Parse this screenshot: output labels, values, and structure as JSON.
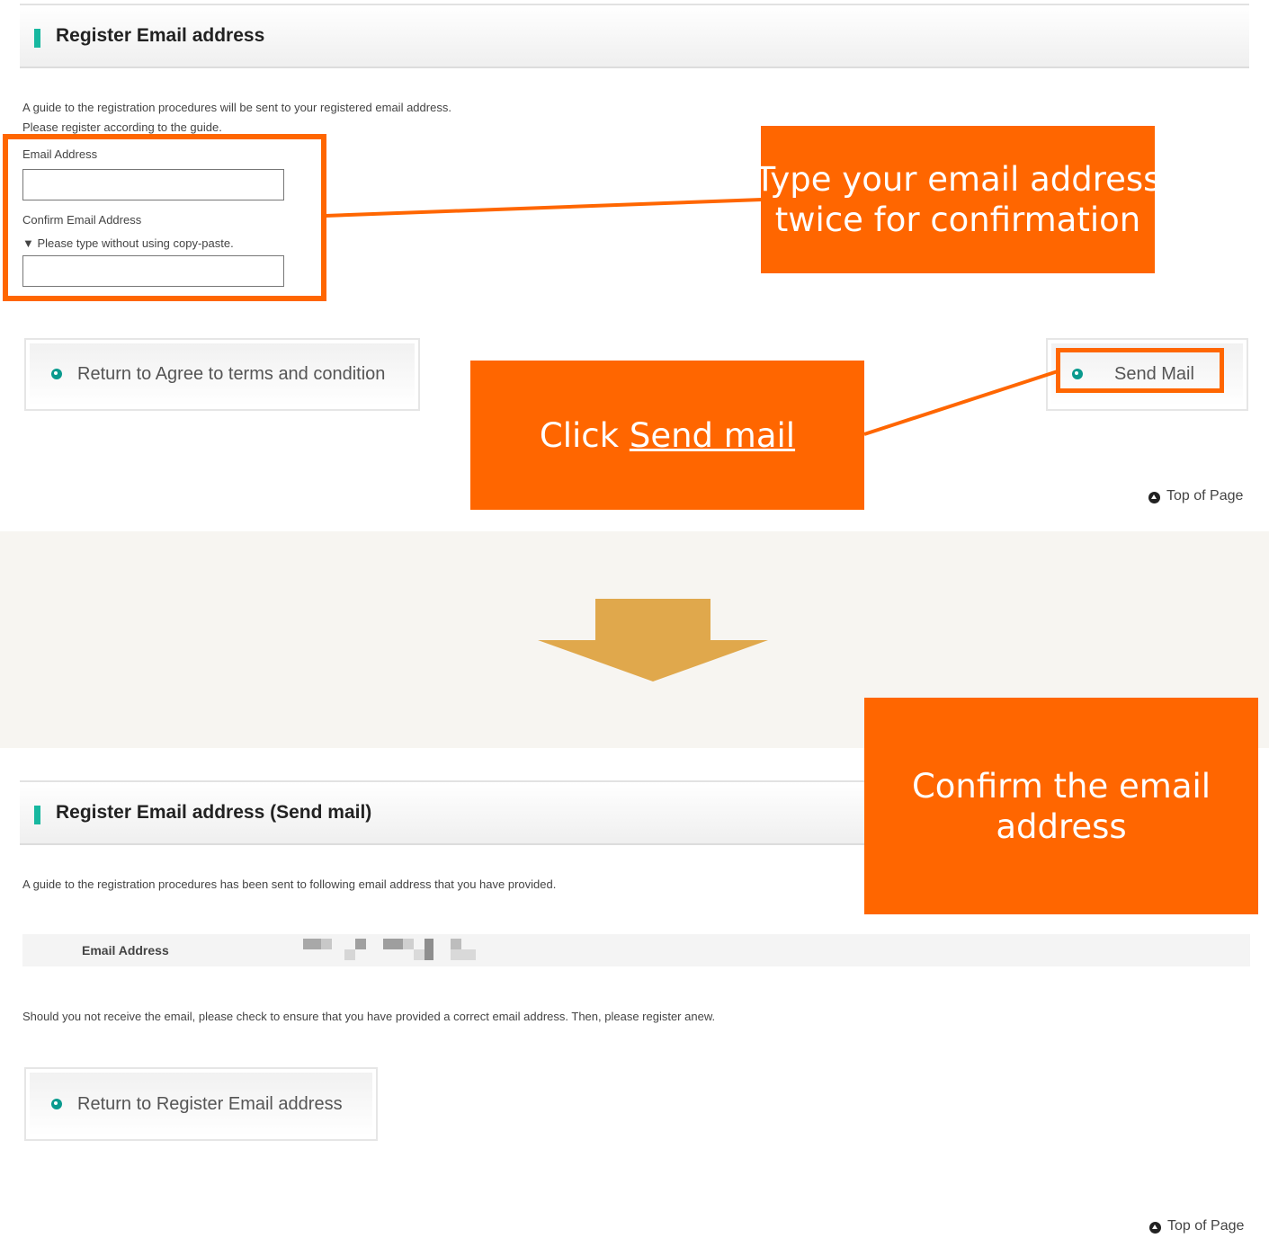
{
  "top_section": {
    "title": "Register Email address",
    "intro_line1": "A guide to the registration procedures will be sent to your registered email address.",
    "intro_line2": "Please register according to the guide.",
    "email_label": "Email Address",
    "email_value": "",
    "confirm_label": "Confirm Email Address",
    "confirm_note": "▼ Please type without using copy-paste.",
    "confirm_value": "",
    "return_button": "Return to Agree to terms and condition",
    "send_button": "Send Mail",
    "top_link": "Top of Page"
  },
  "callouts": {
    "type_email": {
      "line1": "Type your email address",
      "line2": "twice for confirmation"
    },
    "click_send": {
      "prefix": "Click ",
      "link": "Send mail"
    },
    "confirm": {
      "line1": "Confirm the email",
      "line2": "address"
    }
  },
  "bottom_section": {
    "title": "Register Email address (Send mail)",
    "intro": "A guide to the registration procedures has been sent to following email address that you have provided.",
    "email_label": "Email Address",
    "note": "Should you not receive the email, please check to ensure that you have provided a correct email address. Then, please register anew.",
    "return_button": "Return to Register Email address",
    "top_link": "Top of Page"
  },
  "colors": {
    "accent_orange": "#ff6600",
    "arrow_gold": "#e0a84c",
    "teal": "#17b8a0",
    "divider_band": "#f7f5f1"
  }
}
